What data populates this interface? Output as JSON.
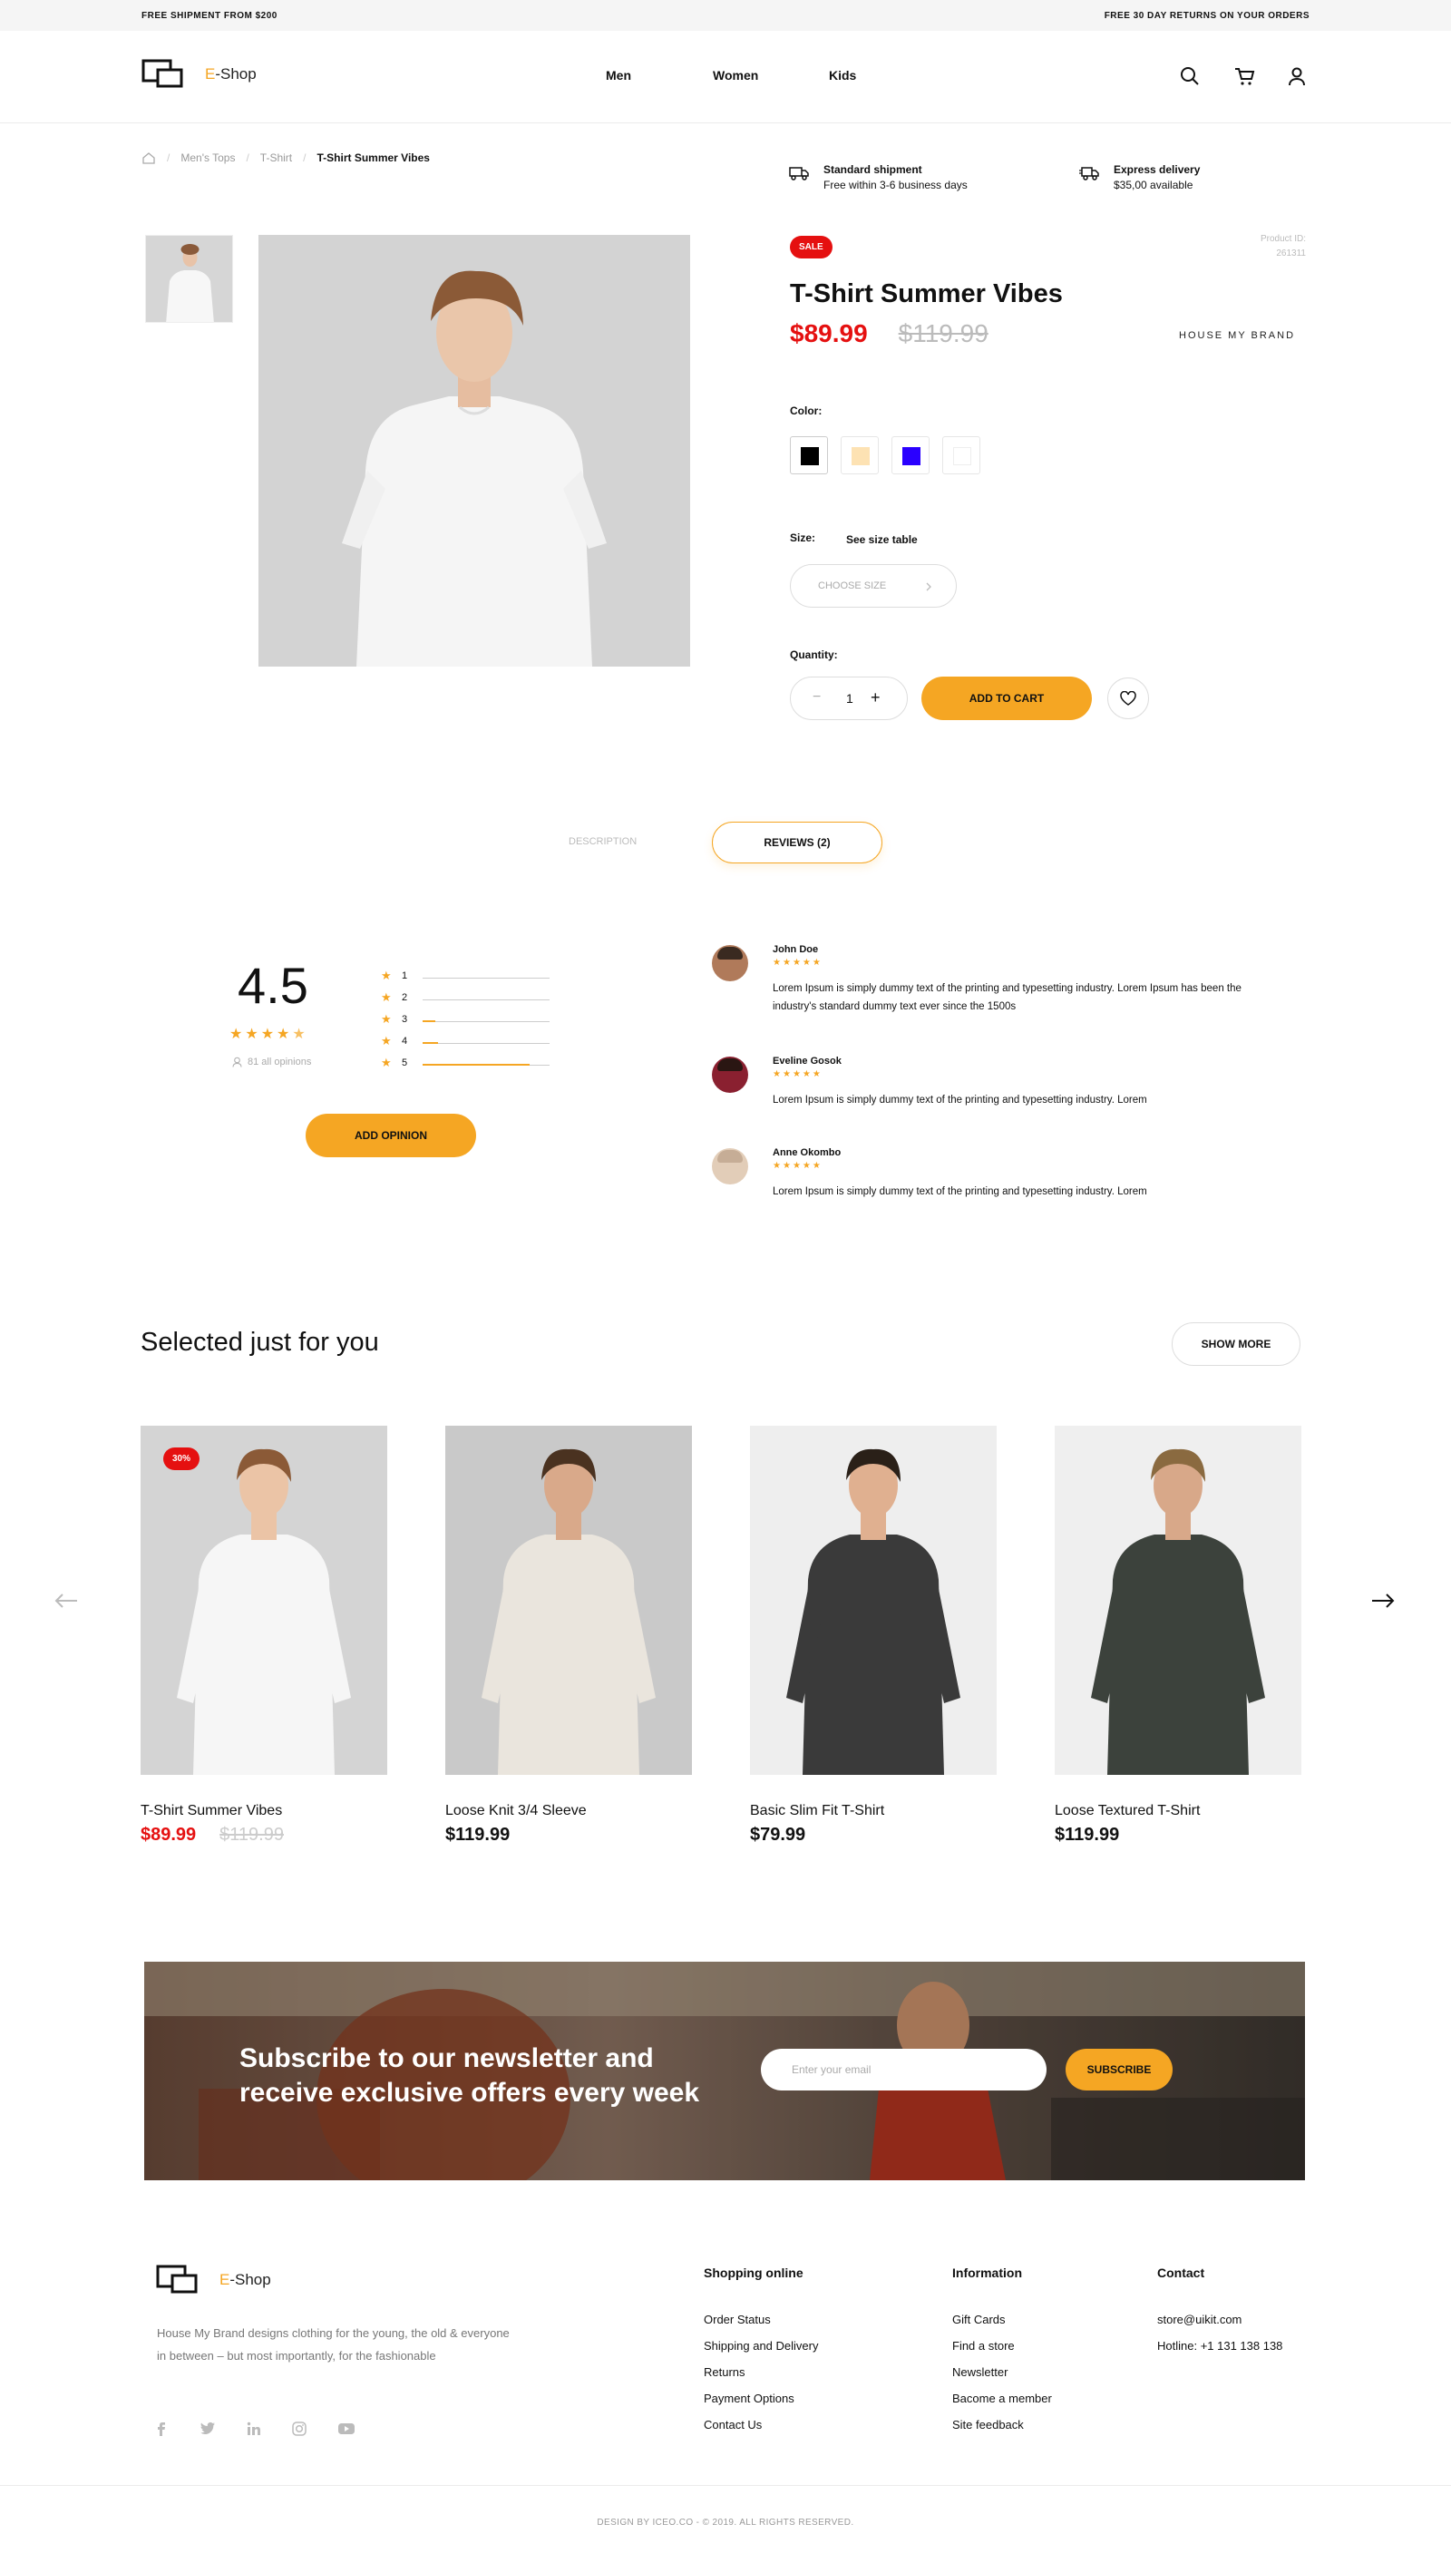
{
  "topbar": {
    "left": "FREE SHIPMENT FROM $200",
    "right": "FREE 30 DAY RETURNS ON YOUR ORDERS"
  },
  "header": {
    "logo_prefix": "E",
    "logo_text": "-Shop",
    "nav": [
      "Men",
      "Women",
      "Kids"
    ],
    "icons": [
      "search-icon",
      "cart-icon",
      "user-icon"
    ]
  },
  "breadcrumb": {
    "home_icon": "home-icon",
    "items": [
      "Men's Tops",
      "T-Shirt",
      "T-Shirt Summer Vibes"
    ]
  },
  "shipping": [
    {
      "icon": "truck-icon",
      "title": "Standard shipment",
      "sub": "Free within 3-6 business days"
    },
    {
      "icon": "fast-truck-icon",
      "title": "Express delivery",
      "sub": "$35,00 available"
    }
  ],
  "product": {
    "badge": "SALE",
    "product_id_label": "Product ID:",
    "product_id": "261311",
    "title": "T-Shirt Summer Vibes",
    "price": "$89.99",
    "old_price": "$119.99",
    "brand": "HOUSE MY BRAND",
    "color_label": "Color:",
    "colors": [
      "#000000",
      "#fde2b3",
      "#2a00ff",
      "#ffffff"
    ],
    "size_label": "Size:",
    "size_table": "See size table",
    "size_placeholder": "CHOOSE SIZE",
    "quantity_label": "Quantity:",
    "quantity": "1",
    "minus": "−",
    "plus": "+",
    "add_to_cart": "ADD TO CART"
  },
  "tabs": [
    "DESCRIPTION",
    "REVIEWS (2)"
  ],
  "rating": {
    "score": "4.5",
    "stars": 4.5,
    "opinions": "81 all opinions",
    "breakdown": [
      {
        "label": "1",
        "fraction": 0.0
      },
      {
        "label": "2",
        "fraction": 0.0
      },
      {
        "label": "3",
        "fraction": 0.1
      },
      {
        "label": "4",
        "fraction": 0.12
      },
      {
        "label": "5",
        "fraction": 0.84
      }
    ],
    "add_opinion": "ADD OPINION"
  },
  "reviews": [
    {
      "name": "John Doe",
      "stars": 5,
      "text": "Lorem Ipsum is simply dummy text of the printing and typesetting industry. Lorem Ipsum has been the industry's standard dummy text ever since the 1500s"
    },
    {
      "name": "Eveline Gosok",
      "stars": 5,
      "text": "Lorem Ipsum is simply dummy text of the printing and typesetting industry. Lorem"
    },
    {
      "name": "Anne Okombo",
      "stars": 5,
      "text": "Lorem Ipsum is simply dummy text of the printing and typesetting industry. Lorem"
    }
  ],
  "selected": {
    "title": "Selected just for you",
    "show_more": "SHOW MORE",
    "products": [
      {
        "name": "T-Shirt Summer Vibes",
        "price": "$89.99",
        "old_price": "$119.99",
        "badge": "30%",
        "shirt": "#f6f6f6"
      },
      {
        "name": "Loose Knit 3/4 Sleeve",
        "price": "$119.99",
        "old_price": "",
        "badge": "",
        "shirt": "#eae5dd"
      },
      {
        "name": "Basic Slim Fit T-Shirt",
        "price": "$79.99",
        "old_price": "",
        "badge": "",
        "shirt": "#3a3a3a"
      },
      {
        "name": "Loose Textured T-Shirt",
        "price": "$119.99",
        "old_price": "",
        "badge": "",
        "shirt": "#3c423c"
      }
    ]
  },
  "newsletter": {
    "text": "Subscribe to our newsletter and receive exclusive offers every week",
    "placeholder": "Enter your email",
    "button": "SUBSCRIBE"
  },
  "footer": {
    "logo_prefix": "E",
    "logo_text": "-Shop",
    "about": "House My Brand designs clothing for the young, the old & everyone in between – but most importantly, for the fashionable",
    "social": [
      "facebook-icon",
      "twitter-icon",
      "linkedin-icon",
      "instagram-icon",
      "youtube-icon"
    ],
    "columns": [
      {
        "title": "Shopping online",
        "links": [
          "Order Status",
          "Shipping and Delivery",
          "Returns",
          "Payment Options",
          "Contact Us"
        ]
      },
      {
        "title": "Information",
        "links": [
          "Gift Cards",
          "Find a store",
          "Newsletter",
          "Bacome a member",
          "Site feedback"
        ]
      },
      {
        "title": "Contact",
        "links": [
          "store@uikit.com",
          "Hotline: +1 131 138 138"
        ]
      }
    ],
    "copyright": "DESIGN BY ICEO.CO - © 2019. ALL RIGHTS RESERVED."
  },
  "colors": {
    "accent": "#f5a623",
    "sale": "#e51010"
  }
}
